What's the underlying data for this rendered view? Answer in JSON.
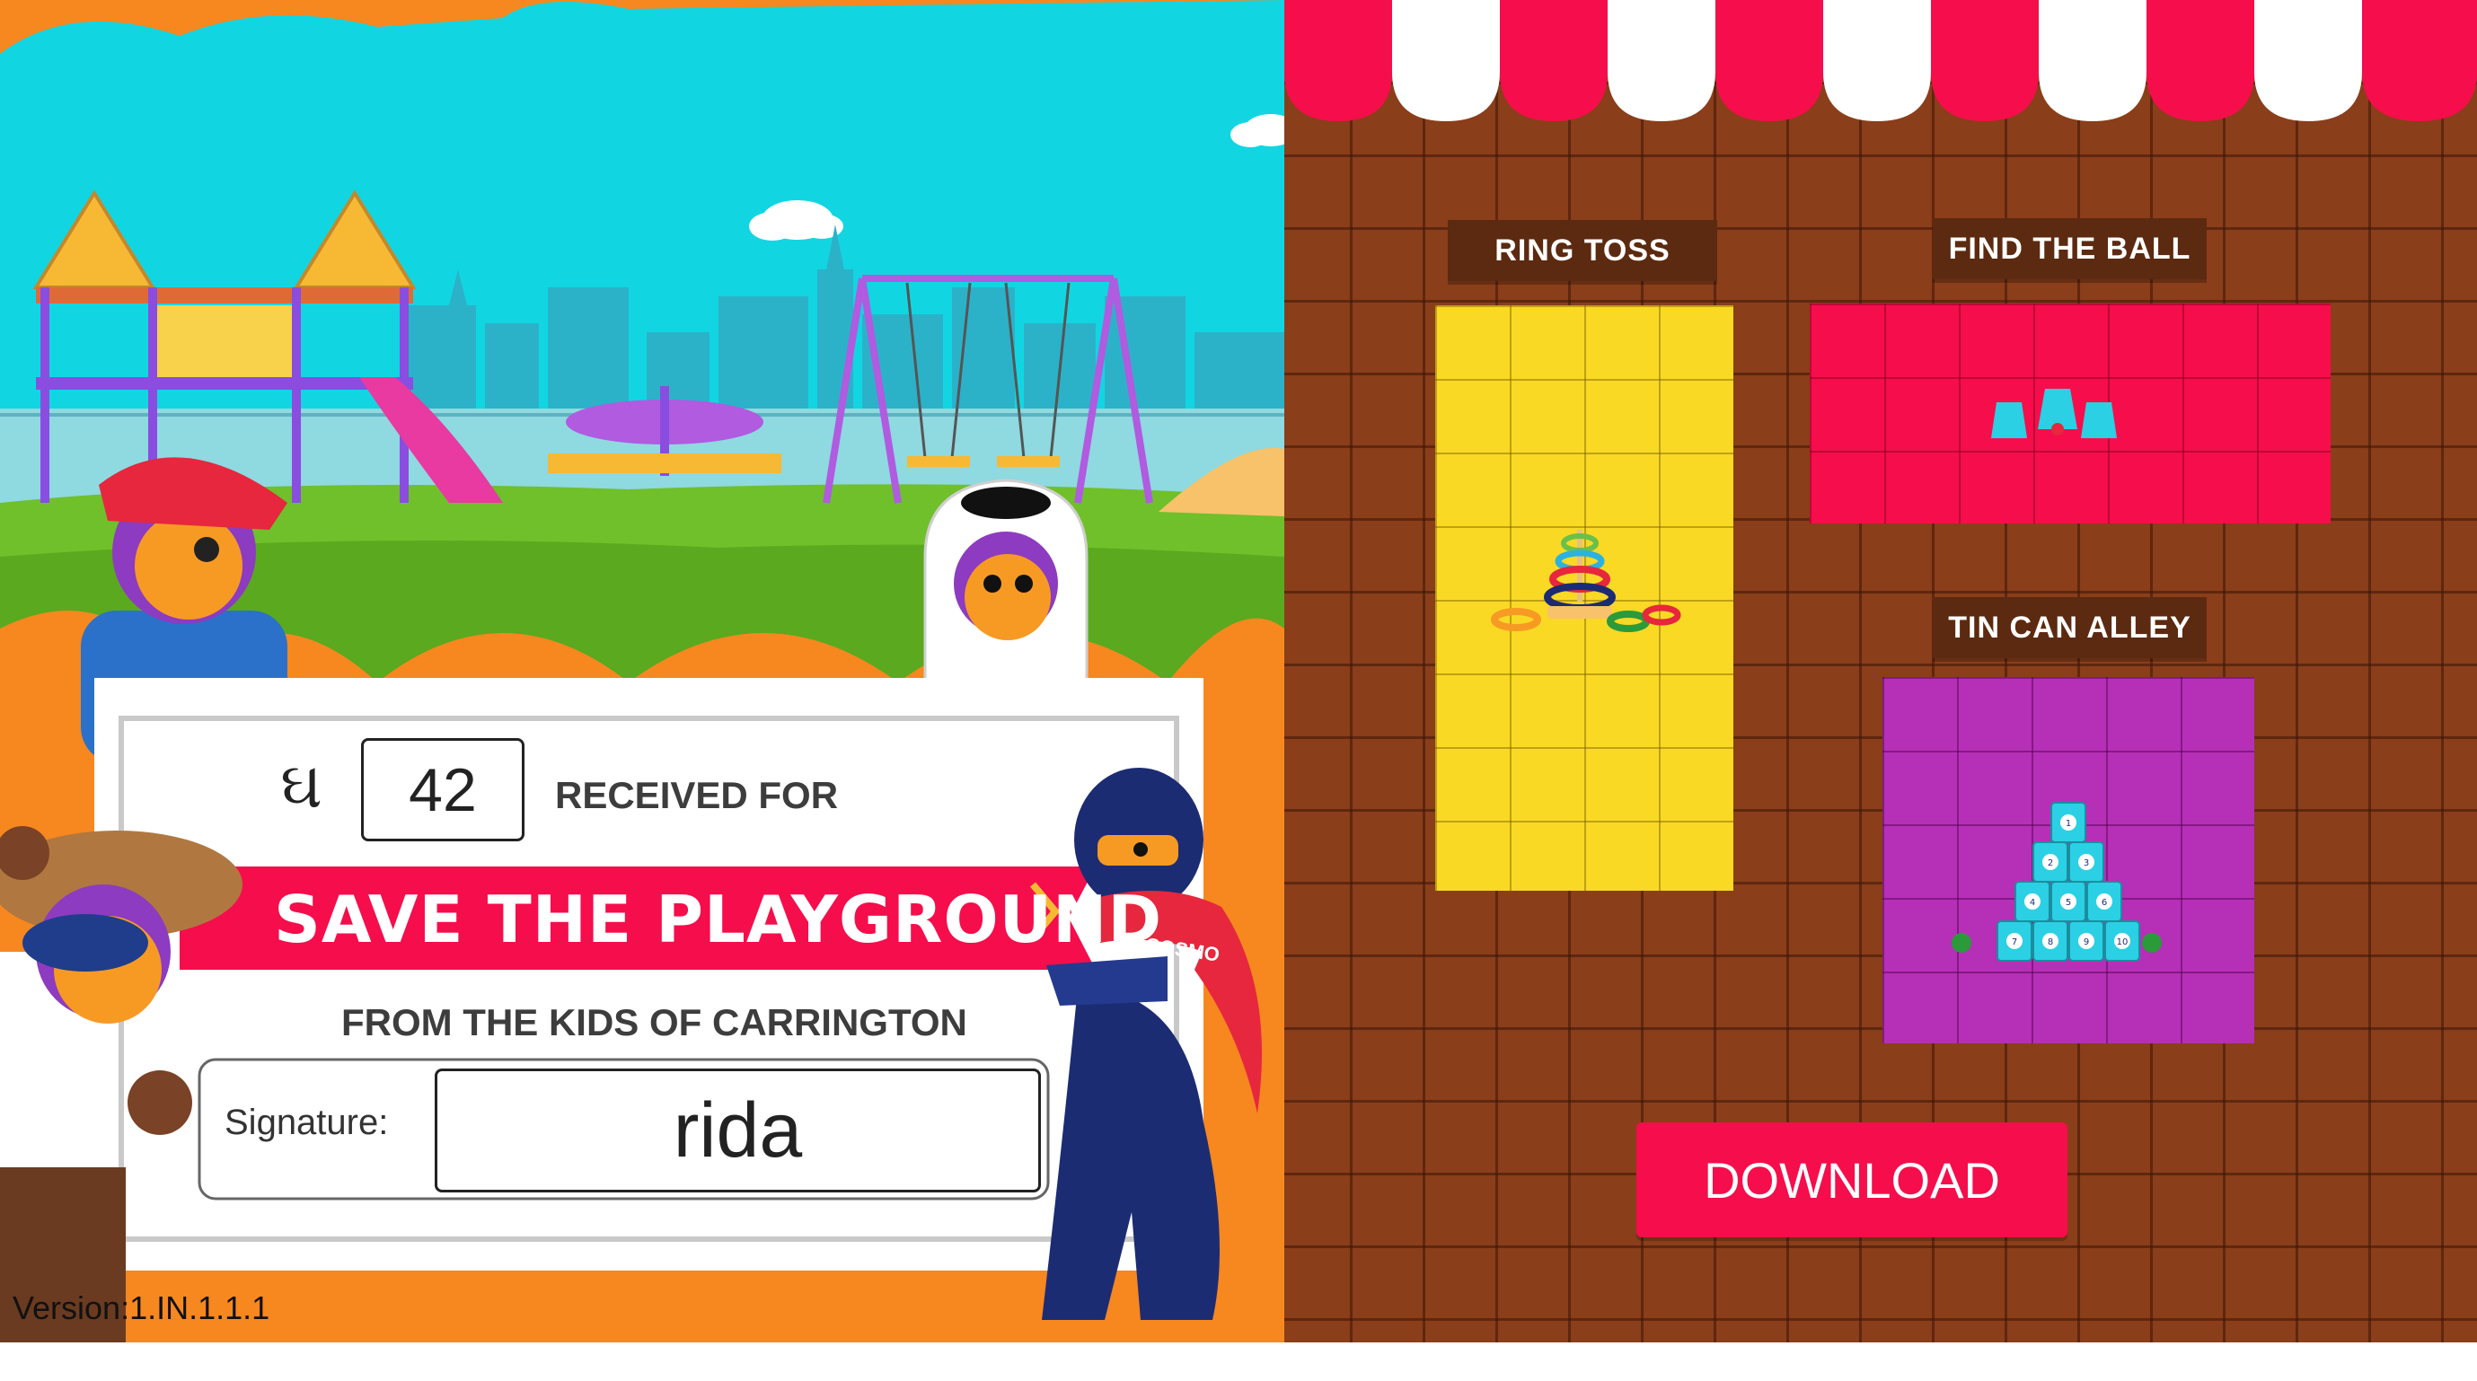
{
  "certificate": {
    "currency_symbol": "ઘ",
    "amount": "42",
    "received_for": "RECEIVED FOR",
    "banner": "SAVE THE PLAYGROUND",
    "from": "FROM THE KIDS OF CARRINGTON",
    "signature_label": "Signature:",
    "signature_value": "rida",
    "badge_text": "COSMO"
  },
  "booths": [
    {
      "label": "RING TOSS",
      "color": "#f9d924"
    },
    {
      "label": "FIND THE BALL",
      "color": "#f50e4b"
    },
    {
      "label": "TIN CAN ALLEY",
      "color": "#b62fb7"
    }
  ],
  "cans": [
    "1",
    "2",
    "3",
    "4",
    "5",
    "6",
    "7",
    "8",
    "9",
    "10"
  ],
  "download_label": "DOWNLOAD",
  "version": "Version:1.IN.1.1.1",
  "colors": {
    "sky": "#11d6e2",
    "orange": "#f7871f",
    "grass": "#6fc02a",
    "banner_red": "#f50e4b",
    "wall_brown": "#8a3e1a",
    "awning_red": "#f50e4b"
  },
  "icons": [
    "playground-icon",
    "ring-stack-icon",
    "cups-icon",
    "tin-can-pyramid-icon",
    "ninja-character",
    "cowboy-character",
    "pirate-character",
    "penguin-character"
  ]
}
